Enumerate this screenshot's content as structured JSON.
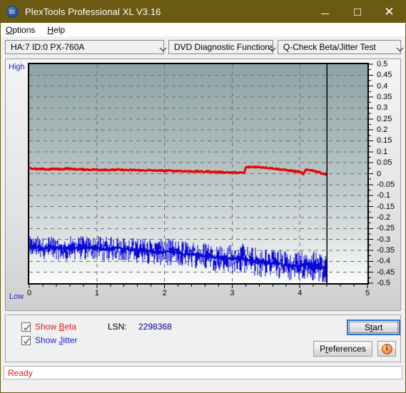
{
  "window": {
    "title": "PlexTools Professional XL V3.16",
    "icon": "xl-app-icon",
    "minimize_label": "─",
    "maximize_label": "□",
    "close_label": "✕",
    "titlebar_color": "#6b5a12"
  },
  "menubar": {
    "items": [
      {
        "label": "Options",
        "mnemonic": "O"
      },
      {
        "label": "Help",
        "mnemonic": "H"
      }
    ]
  },
  "toolbar": {
    "drive_select": {
      "value": "HA:7 ID:0  PX-760A",
      "options": [
        "HA:7 ID:0  PX-760A"
      ]
    },
    "function_select": {
      "value": "DVD Diagnostic Functions",
      "options": [
        "DVD Diagnostic Functions"
      ]
    },
    "test_select": {
      "value": "Q-Check Beta/Jitter Test",
      "options": [
        "Q-Check Beta/Jitter Test"
      ]
    }
  },
  "chart_data": {
    "type": "line",
    "title": "",
    "xlabel": "",
    "ylabel": "",
    "xlim": [
      0,
      5
    ],
    "ylim": [
      -0.5,
      0.5
    ],
    "grid": true,
    "axis_left_label": "High",
    "axis_bottom_left_label": "Low",
    "x_ticks": [
      0,
      1,
      2,
      3,
      4,
      5
    ],
    "x_minor_step": 0.2,
    "y_ticks": [
      0.5,
      0.45,
      0.4,
      0.35,
      0.3,
      0.25,
      0.2,
      0.15,
      0.1,
      0.05,
      0,
      -0.05,
      -0.1,
      -0.15,
      -0.2,
      -0.25,
      -0.3,
      -0.35,
      -0.4,
      -0.45,
      -0.5
    ],
    "y_tick_labels": [
      "0.5",
      "0.45",
      "0.4",
      "0.35",
      "0.3",
      "0.25",
      "0.2",
      "0.15",
      "0.1",
      "0.05",
      "0",
      "-0.05",
      "-0.1",
      "-0.15",
      "-0.2",
      "-0.25",
      "-0.3",
      "-0.35",
      "-0.4",
      "-0.45",
      "-0.5"
    ],
    "data_end_marker_x": 4.4,
    "series": [
      {
        "name": "Beta",
        "color": "#ee0000",
        "x": [
          0.0,
          0.05,
          0.1,
          0.15,
          0.2,
          0.25,
          0.3,
          0.35,
          0.4,
          0.45,
          0.5,
          0.55,
          0.6,
          0.65,
          0.7,
          0.75,
          0.8,
          0.85,
          0.9,
          0.95,
          1.0,
          1.05,
          1.1,
          1.15,
          1.2,
          1.25,
          1.3,
          1.35,
          1.4,
          1.45,
          1.5,
          1.55,
          1.6,
          1.65,
          1.7,
          1.75,
          1.8,
          1.85,
          1.9,
          1.95,
          2.0,
          2.05,
          2.1,
          2.15,
          2.2,
          2.25,
          2.3,
          2.35,
          2.4,
          2.45,
          2.5,
          2.55,
          2.6,
          2.65,
          2.7,
          2.75,
          2.8,
          2.85,
          2.9,
          2.95,
          3.0,
          3.05,
          3.1,
          3.15,
          3.18,
          3.2,
          3.25,
          3.3,
          3.35,
          3.4,
          3.45,
          3.5,
          3.55,
          3.6,
          3.65,
          3.7,
          3.75,
          3.8,
          3.85,
          3.9,
          3.95,
          4.0,
          4.03,
          4.05,
          4.08,
          4.1,
          4.15,
          4.2,
          4.25,
          4.3,
          4.35,
          4.4
        ],
        "y": [
          0.028,
          0.022,
          0.021,
          0.02,
          0.021,
          0.02,
          0.02,
          0.022,
          0.021,
          0.02,
          0.021,
          0.024,
          0.022,
          0.021,
          0.02,
          0.02,
          0.019,
          0.019,
          0.018,
          0.019,
          0.018,
          0.018,
          0.019,
          0.018,
          0.017,
          0.017,
          0.018,
          0.017,
          0.017,
          0.016,
          0.016,
          0.017,
          0.016,
          0.015,
          0.015,
          0.016,
          0.015,
          0.014,
          0.014,
          0.014,
          0.013,
          0.014,
          0.013,
          0.012,
          0.013,
          0.012,
          0.011,
          0.011,
          0.01,
          0.011,
          0.01,
          0.009,
          0.009,
          0.01,
          0.008,
          0.008,
          0.007,
          0.007,
          0.006,
          0.006,
          0.005,
          0.005,
          0.004,
          0.004,
          0.003,
          0.029,
          0.03,
          0.031,
          0.031,
          0.03,
          0.029,
          0.028,
          0.026,
          0.024,
          0.022,
          0.02,
          0.018,
          0.016,
          0.014,
          0.012,
          0.01,
          0.008,
          0.004,
          -0.005,
          0.014,
          0.018,
          0.017,
          0.014,
          0.01,
          0.005,
          0.0,
          -0.004
        ]
      },
      {
        "name": "Jitter",
        "color": "#0a0ad8",
        "band_note": "noisy band, plotted as min/max envelope",
        "x": [
          0.0,
          0.1,
          0.2,
          0.3,
          0.4,
          0.5,
          0.6,
          0.7,
          0.8,
          0.9,
          1.0,
          1.1,
          1.2,
          1.3,
          1.4,
          1.5,
          1.6,
          1.7,
          1.8,
          1.9,
          2.0,
          2.1,
          2.2,
          2.3,
          2.4,
          2.5,
          2.6,
          2.7,
          2.8,
          2.9,
          3.0,
          3.1,
          3.2,
          3.3,
          3.4,
          3.5,
          3.6,
          3.7,
          3.8,
          3.9,
          4.0,
          4.1,
          4.2,
          4.3,
          4.4
        ],
        "y_center": [
          -0.335,
          -0.335,
          -0.34,
          -0.338,
          -0.34,
          -0.345,
          -0.34,
          -0.338,
          -0.34,
          -0.338,
          -0.34,
          -0.345,
          -0.342,
          -0.34,
          -0.345,
          -0.348,
          -0.35,
          -0.352,
          -0.355,
          -0.358,
          -0.36,
          -0.358,
          -0.362,
          -0.365,
          -0.368,
          -0.37,
          -0.375,
          -0.378,
          -0.382,
          -0.385,
          -0.388,
          -0.385,
          -0.39,
          -0.4,
          -0.405,
          -0.41,
          -0.408,
          -0.412,
          -0.42,
          -0.425,
          -0.422,
          -0.41,
          -0.418,
          -0.428,
          -0.432
        ],
        "y_min": [
          -0.375,
          -0.378,
          -0.382,
          -0.38,
          -0.382,
          -0.39,
          -0.385,
          -0.382,
          -0.385,
          -0.382,
          -0.386,
          -0.392,
          -0.388,
          -0.385,
          -0.392,
          -0.396,
          -0.398,
          -0.4,
          -0.404,
          -0.408,
          -0.41,
          -0.408,
          -0.414,
          -0.418,
          -0.42,
          -0.424,
          -0.43,
          -0.434,
          -0.438,
          -0.442,
          -0.445,
          -0.44,
          -0.448,
          -0.458,
          -0.462,
          -0.468,
          -0.465,
          -0.47,
          -0.478,
          -0.482,
          -0.478,
          -0.462,
          -0.472,
          -0.482,
          -0.486
        ],
        "y_max": [
          -0.295,
          -0.292,
          -0.298,
          -0.296,
          -0.298,
          -0.3,
          -0.296,
          -0.294,
          -0.296,
          -0.294,
          -0.296,
          -0.3,
          -0.298,
          -0.295,
          -0.3,
          -0.302,
          -0.304,
          -0.306,
          -0.308,
          -0.31,
          -0.312,
          -0.31,
          -0.314,
          -0.316,
          -0.32,
          -0.322,
          -0.326,
          -0.328,
          -0.332,
          -0.335,
          -0.338,
          -0.334,
          -0.34,
          -0.348,
          -0.352,
          -0.356,
          -0.354,
          -0.358,
          -0.364,
          -0.368,
          -0.364,
          -0.352,
          -0.36,
          -0.37,
          -0.374
        ]
      }
    ]
  },
  "controls": {
    "show_beta": {
      "label_pre": "Show ",
      "label_mnemonic": "B",
      "label_post": "eta",
      "checked": true,
      "color": "#e01b1b"
    },
    "show_jitter": {
      "label_pre": "Show ",
      "label_mnemonic": "J",
      "label_post": "itter",
      "checked": true,
      "color": "#1b1be0"
    },
    "lsn_label": "LSN:",
    "lsn_value": "2298368",
    "start_button": {
      "label_pre": "S",
      "label_mnemonic": "t",
      "label_post": "art",
      "full": "Start",
      "focused": true
    },
    "preferences_button": {
      "label_pre": "P",
      "label_mnemonic": "r",
      "label_post": "eferences",
      "full": "Preferences"
    },
    "info_button": {
      "glyph": "i",
      "name": "info-icon"
    }
  },
  "statusbar": {
    "text": "Ready",
    "color": "#e01b1b"
  }
}
